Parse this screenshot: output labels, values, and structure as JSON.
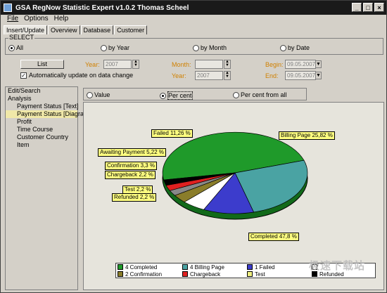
{
  "window": {
    "title": "GSA RegNow Statistic Expert v1.0.2  Thomas Scheel",
    "btn_min": "_",
    "btn_max": "□",
    "btn_close": "×"
  },
  "menu": [
    "File",
    "Options",
    "Help"
  ],
  "tabs": [
    "Insert/Update",
    "Overview",
    "Database",
    "Customer"
  ],
  "select": {
    "legend": "SELECT",
    "options": [
      "All",
      "by Year",
      "by Month",
      "by Date"
    ],
    "selected": "All"
  },
  "controls": {
    "list_button": "List",
    "auto_update_label": "Automatically update on data change",
    "auto_update_checked": true,
    "year_label": "Year:",
    "year_value": "2007",
    "month_label": "Month:",
    "month_value": "",
    "year2_label": "Year:",
    "year2_value": "2007",
    "begin_label": "Begin:",
    "begin_value": "09.05.2007",
    "end_label": "End:",
    "end_value": "09.05.2007"
  },
  "tree": {
    "items": [
      "Edit/Search",
      "Analysis",
      "Payment Status [Text]",
      "Payment Status [Diagram]",
      "Profit",
      "Time Course",
      "Customer Country",
      "Item"
    ]
  },
  "view": {
    "options": [
      "Value",
      "Per cent",
      "Per cent from all"
    ],
    "selected": "Per cent"
  },
  "chart_data": {
    "type": "pie",
    "series": [
      {
        "name": "Completed",
        "value": 47.8,
        "label": "Completed 47,8 %",
        "color": "#1f9a2a"
      },
      {
        "name": "Billing Page",
        "value": 25.82,
        "label": "Billing Page 25,82 %",
        "color": "#4aa3a3"
      },
      {
        "name": "Failed",
        "value": 11.26,
        "label": "Failed 11,26 %",
        "color": "#3c3ccc"
      },
      {
        "name": "Awaiting Payment",
        "value": 5.22,
        "label": "Awaiting Payment 5,22 %",
        "color": "#ffffff"
      },
      {
        "name": "Confirmation",
        "value": 3.3,
        "label": "Confirmation 3,3 %",
        "color": "#8a7d2a"
      },
      {
        "name": "Chargeback",
        "value": 2.2,
        "label": "Chargeback 2,2 %",
        "color": "#888888"
      },
      {
        "name": "Test",
        "value": 2.2,
        "label": "Test 2,2 %",
        "color": "#e02020"
      },
      {
        "name": "Refunded",
        "value": 2.2,
        "label": "Refunded 2,2 %",
        "color": "#000000"
      }
    ],
    "legend": [
      {
        "label": "4 Completed",
        "color": "#1f9a2a"
      },
      {
        "label": "4 Billing Page",
        "color": "#4aa3a3"
      },
      {
        "label": "1 Failed",
        "color": "#3c3ccc"
      },
      {
        "label": "",
        "color": "#ffffff"
      },
      {
        "label": "2 Confirmation",
        "color": "#8a7d2a"
      },
      {
        "label": "Chargeback",
        "color": "#e02020"
      },
      {
        "label": "Test",
        "color": "#f0f080"
      },
      {
        "label": "Refunded",
        "color": "#000000"
      }
    ]
  },
  "watermark": "极速下载站"
}
